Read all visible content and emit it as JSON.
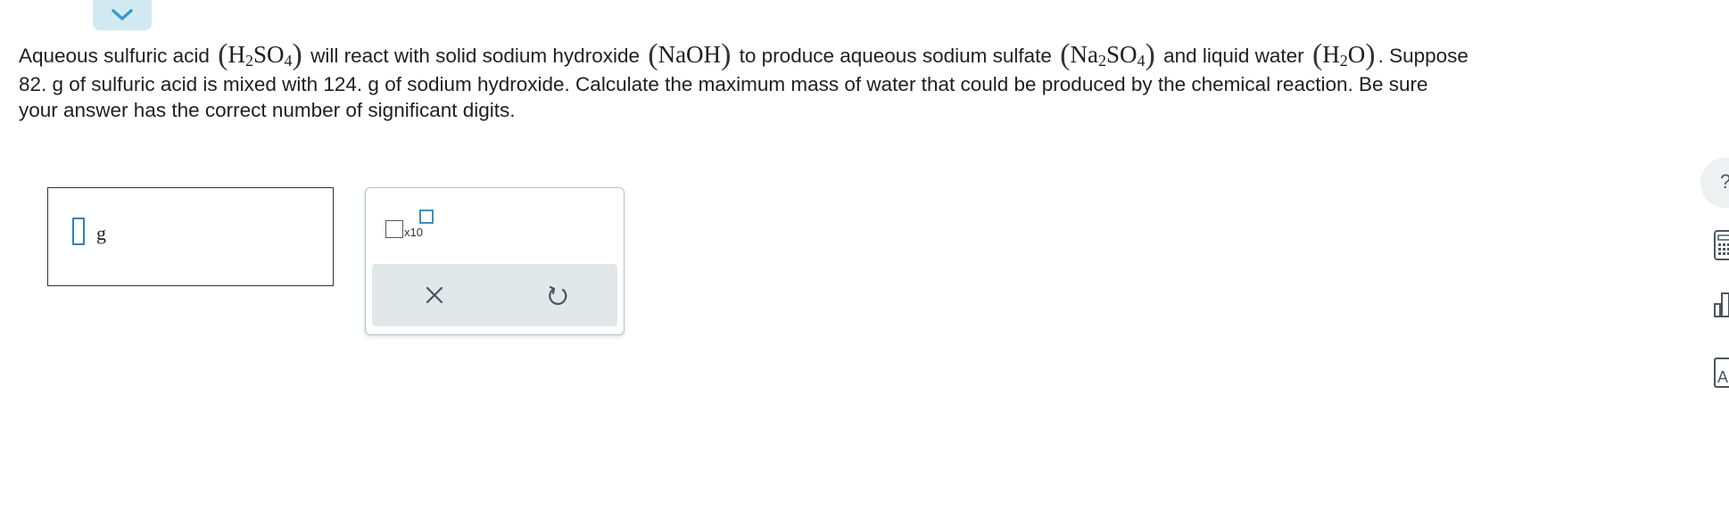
{
  "question": {
    "line1": {
      "t1": "Aqueous sulfuric acid",
      "t2": "will react with solid sodium hydroxide",
      "t3": "to produce aqueous sodium sulfate",
      "t4": "and liquid water",
      "t5": ". Suppose"
    },
    "formulas": {
      "h2so4": {
        "a": "H",
        "sub1": "2",
        "b": "SO",
        "sub2": "4"
      },
      "naoh": "NaOH",
      "na2so4": {
        "a": "Na",
        "sub1": "2",
        "b": "SO",
        "sub2": "4"
      },
      "h2o": {
        "a": "H",
        "sub1": "2",
        "b": "O"
      },
      "open_paren": "(",
      "close_paren": ")"
    },
    "line2": "82. g of sulfuric acid is mixed with 124. g of sodium hydroxide. Calculate the maximum mass of water that could be produced by the chemical reaction. Be sure",
    "line3": "your answer has the correct number of significant digits."
  },
  "answer": {
    "value": "",
    "unit": "g"
  },
  "tools": {
    "x10_label": "x10"
  },
  "icons": {
    "collapse": "chevron-down-icon",
    "clear": "close-icon",
    "reset": "undo-icon",
    "help": "help-icon",
    "calculator": "calculator-icon",
    "chart": "bar-chart-icon",
    "periodic_table": "periodic-table-icon"
  },
  "colors": {
    "accent": "#2d7fc3",
    "tab": "#d3e9f1",
    "panel_bar": "#e2e7ea"
  },
  "side": {
    "help_glyph": "?",
    "periodic_glyph": "A"
  }
}
